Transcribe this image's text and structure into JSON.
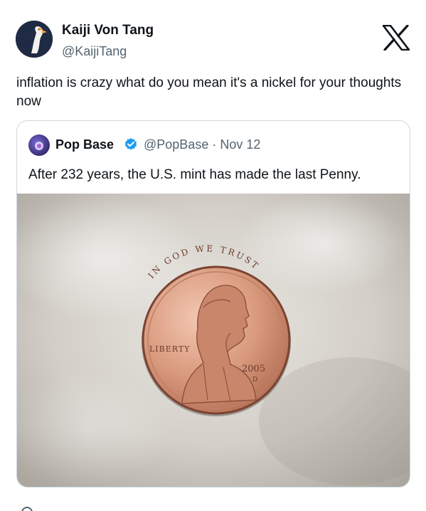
{
  "tweet": {
    "author_name": "Kaiji Von Tang",
    "author_handle": "@KaijiTang",
    "text": "inflation is crazy what do you mean it's a nickel for your thoughts now",
    "icons": {
      "avatar": "avatar",
      "platform": "x-logo-icon"
    }
  },
  "quote": {
    "author_name": "Pop Base",
    "handle_date": "@PopBase · Nov 12",
    "verified": true,
    "text": "After 232 years, the U.S. mint has made the last Penny.",
    "icons": {
      "avatar": "avatar",
      "badge": "verified-badge-icon"
    }
  },
  "coin": {
    "motto": "IN GOD WE TRUST",
    "liberty": "LIBERTY",
    "year": "2005",
    "mint_mark": "D"
  },
  "colors": {
    "text_primary": "#0f1419",
    "text_secondary": "#536471",
    "border": "#cfd9de",
    "verified_blue": "#1d9bf0",
    "copper": "#d89a7f"
  }
}
